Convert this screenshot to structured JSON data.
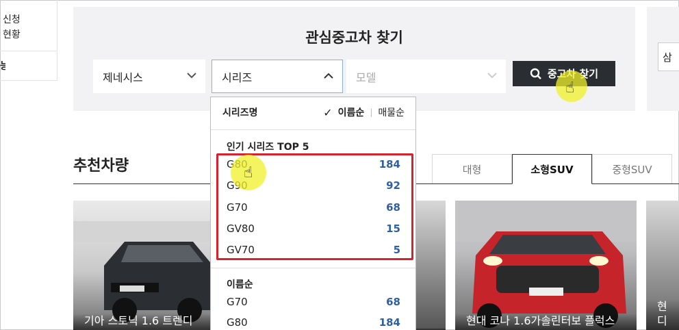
{
  "sidebar": {
    "line1": "신청",
    "line2": "현황",
    "fragment": "능"
  },
  "search_panel": {
    "title": "관심중고차 찾기",
    "brand_select": "제네시스",
    "series_select": "시리즈",
    "model_select": "모델",
    "find_button": "중고차 찾기",
    "right_fragment": "삼"
  },
  "dropdown": {
    "header_label": "시리즈명",
    "sort_name": "이름순",
    "sort_count": "매물순",
    "popular_title": "인기 시리즈 TOP 5",
    "popular": [
      {
        "name": "G80",
        "count": "184"
      },
      {
        "name": "G90",
        "count": "92"
      },
      {
        "name": "G70",
        "count": "68"
      },
      {
        "name": "GV80",
        "count": "15"
      },
      {
        "name": "GV70",
        "count": "5"
      }
    ],
    "alpha_title": "이름순",
    "alpha": [
      {
        "name": "G70",
        "count": "68"
      },
      {
        "name": "G80",
        "count": "184"
      }
    ]
  },
  "recommend": {
    "title": "추천차량",
    "tab_fragment": "!",
    "tabs": [
      "대형",
      "소형SUV",
      "중형SUV"
    ],
    "active_tab": "소형SUV",
    "cards": [
      {
        "caption": "기아 스토닉 1.6 트렌디"
      },
      {
        "caption": ""
      },
      {
        "caption": "현대 코나 1.6가솔린터보 플럭스"
      },
      {
        "caption": "현디"
      }
    ]
  },
  "colors": {
    "panel_bg": "#f2f2f4",
    "button_bg": "#2a2d31",
    "count_blue": "#2f5fa7",
    "highlight_red": "#d7212d"
  }
}
